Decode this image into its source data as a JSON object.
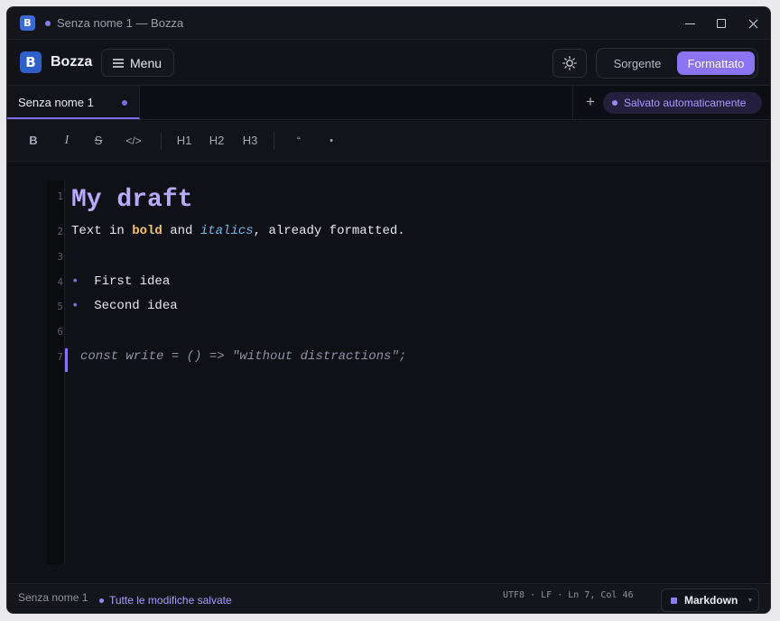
{
  "window": {
    "title": "Senza nome 1 — Bozza",
    "logo_letter": "B"
  },
  "header": {
    "brand": "Bozza",
    "menu_label": "Menu",
    "view_modes": [
      "Sorgente",
      "Formattato"
    ],
    "active_mode": "Formattato"
  },
  "tabs": [
    {
      "label": "Senza nome 1",
      "modified": true,
      "active": true
    }
  ],
  "tabs_actions": {
    "add_label": "+",
    "autosave_label": "Salvato automaticamente"
  },
  "toolbar": {
    "bold": "B",
    "italic": "I",
    "strike": "S",
    "code": "</>",
    "h1": "H1",
    "h2": "H2",
    "h3": "H3",
    "quote": "“",
    "bullet": "•"
  },
  "editor": {
    "line_numbers": [
      "1",
      "2",
      "3",
      "4",
      "5",
      "6",
      "7"
    ],
    "heading": "My draft",
    "line2": {
      "pre": "Text in ",
      "bold": "bold",
      "mid": " and ",
      "italic": "italics",
      "post": ", already formatted."
    },
    "bullets": [
      "First idea",
      "Second idea"
    ],
    "code": "const write = () => \"without distractions\";"
  },
  "status": {
    "file": "Senza nome 1",
    "saved": "Tutte le modifiche salvate",
    "info": "UTF8 · LF · Ln 7, Col 46",
    "language": "Markdown"
  },
  "colors": {
    "accent": "#8a74f4",
    "background": "#101117",
    "heading": "#b9a9ff",
    "bold": "#f5c26b",
    "italic": "#6fb7e8"
  }
}
